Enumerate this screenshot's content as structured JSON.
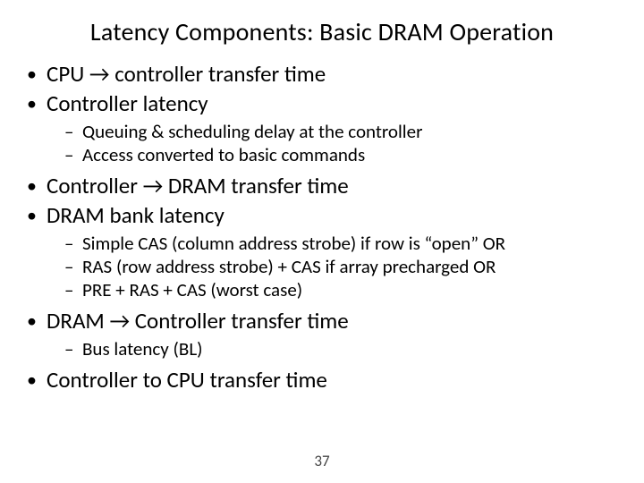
{
  "title": "Latency Components: Basic DRAM Operation",
  "b1": "CPU → controller transfer time",
  "b2": "Controller latency",
  "b2s1": "Queuing & scheduling delay at the controller",
  "b2s2": "Access converted to basic commands",
  "b3": "Controller → DRAM transfer time",
  "b4": "DRAM bank latency",
  "b4s1": "Simple CAS (column address strobe) if row is “open” OR",
  "b4s2": "RAS (row address strobe) + CAS if array precharged OR",
  "b4s3": "PRE + RAS + CAS (worst case)",
  "b5": "DRAM → Controller transfer time",
  "b5s1": "Bus latency (BL)",
  "b6": "Controller to CPU transfer time",
  "page": "37"
}
